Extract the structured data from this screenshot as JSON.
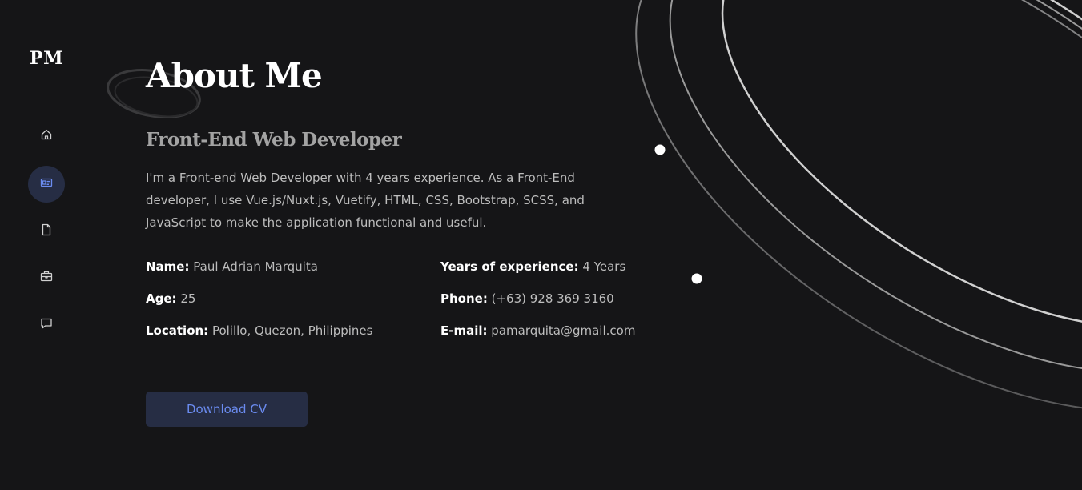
{
  "sidebar": {
    "logo": "PM",
    "nav": [
      {
        "icon": "home-icon",
        "active": false
      },
      {
        "icon": "id-card-icon",
        "active": true
      },
      {
        "icon": "document-icon",
        "active": false
      },
      {
        "icon": "briefcase-icon",
        "active": false
      },
      {
        "icon": "chat-bubble-icon",
        "active": false
      }
    ]
  },
  "main": {
    "title": "About Me",
    "role": "Front-End Web Developer",
    "bio": "I'm a Front-end Web Developer with 4 years experience. As a Front-End developer, I use Vue.js/Nuxt.js, Vuetify, HTML, CSS, Bootstrap, SCSS, and JavaScript to make the application functional and useful.",
    "info_left": [
      {
        "label": "Name:",
        "value": "Paul Adrian Marquita"
      },
      {
        "label": "Age:",
        "value": "25"
      },
      {
        "label": "Location:",
        "value": "Polillo, Quezon, Philippines"
      }
    ],
    "info_right": [
      {
        "label": "Years of experience:",
        "value": "4 Years"
      },
      {
        "label": "Phone:",
        "value": "(+63) 928 369 3160"
      },
      {
        "label": "E-mail:",
        "value": "pamarquita@gmail.com"
      }
    ],
    "download_label": "Download CV"
  },
  "colors": {
    "background": "#151517",
    "accent": "#6b8cf1",
    "button_bg": "#262d44",
    "active_nav_bg": "#262d44"
  }
}
